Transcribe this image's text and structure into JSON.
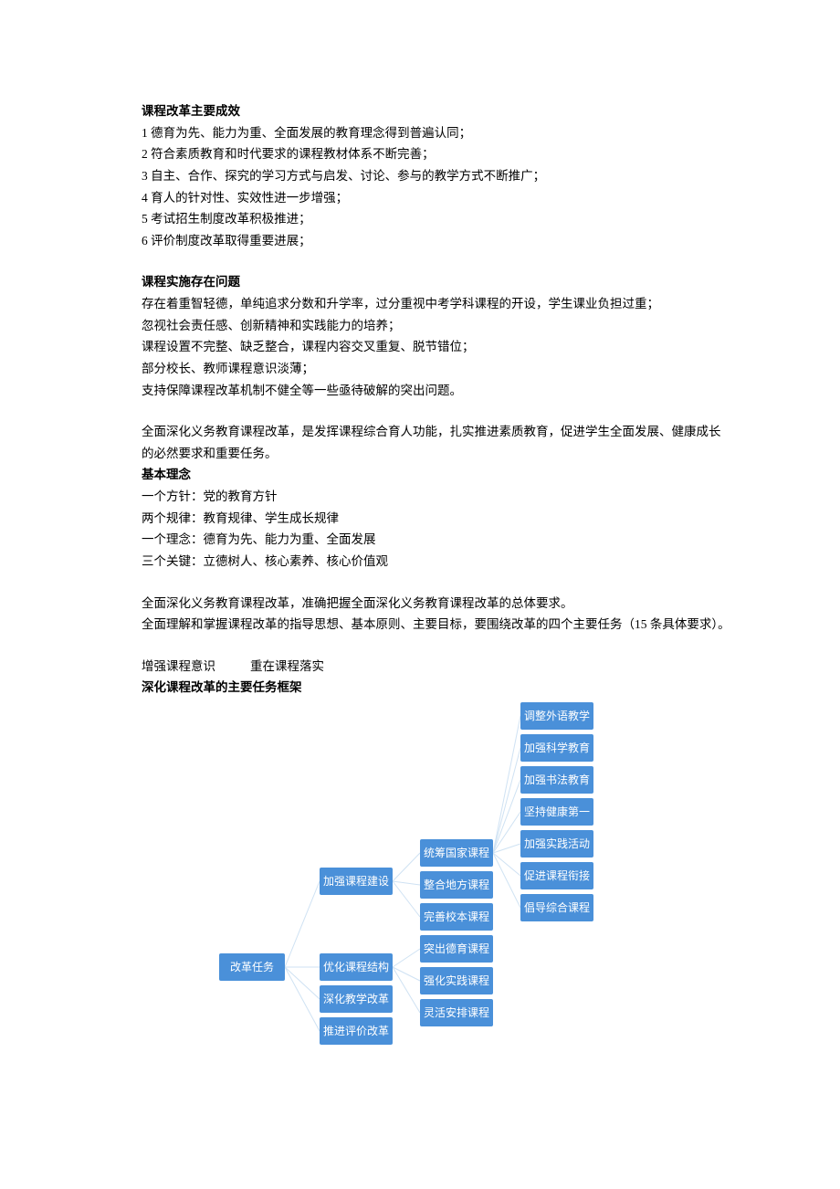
{
  "section1": {
    "title": "课程改革主要成效",
    "items": [
      "1 德育为先、能力为重、全面发展的教育理念得到普遍认同；",
      "2 符合素质教育和时代要求的课程教材体系不断完善；",
      "3 自主、合作、探究的学习方式与启发、讨论、参与的教学方式不断推广；",
      "4 育人的针对性、实效性进一步增强；",
      "5 考试招生制度改革积极推进；",
      "6 评价制度改革取得重要进展；"
    ]
  },
  "section2": {
    "title": "课程实施存在问题",
    "items": [
      "存在着重智轻德，单纯追求分数和升学率，过分重视中考学科课程的开设，学生课业负担过重；",
      "忽视社会责任感、创新精神和实践能力的培养；",
      "课程设置不完整、缺乏整合，课程内容交叉重复、脱节错位；",
      "部分校长、教师课程意识淡薄；",
      "支持保障课程改革机制不健全等一些亟待破解的突出问题。"
    ]
  },
  "para_after_s2": "全面深化义务教育课程改革，是发挥课程综合育人功能，扎实推进素质教育，促进学生全面发展、健康成长的必然要求和重要任务。",
  "section3": {
    "title": "基本理念",
    "items": [
      "一个方针：党的教育方针",
      "两个规律：教育规律、学生成长规律",
      "一个理念：德育为先、能力为重、全面发展",
      "三个关键：立德树人、核心素养、核心价值观"
    ]
  },
  "para_after_s3a": "全面深化义务教育课程改革，准确把握全面深化义务教育课程改革的总体要求。",
  "para_after_s3b": "全面理解和掌握课程改革的指导思想、基本原则、主要目标，要围绕改革的四个主要任务（15 条具体要求）。",
  "line_pair": {
    "left": "增强课程意识",
    "right": "重在课程落实"
  },
  "section4_title": "深化课程改革的主要任务框架",
  "diagram": {
    "root": "改革任务",
    "level2": [
      "加强课程建设",
      "优化课程结构",
      "深化教学改革",
      "推进评价改革"
    ],
    "level3_group_a": [
      "统筹国家课程",
      "整合地方课程",
      "完善校本课程"
    ],
    "level3_group_b": [
      "突出德育课程",
      "强化实践课程",
      "灵活安排课程"
    ],
    "level4": [
      "调整外语教学",
      "加强科学教育",
      "加强书法教育",
      "坚持健康第一",
      "加强实践活动",
      "促进课程衔接",
      "倡导综合课程"
    ]
  }
}
